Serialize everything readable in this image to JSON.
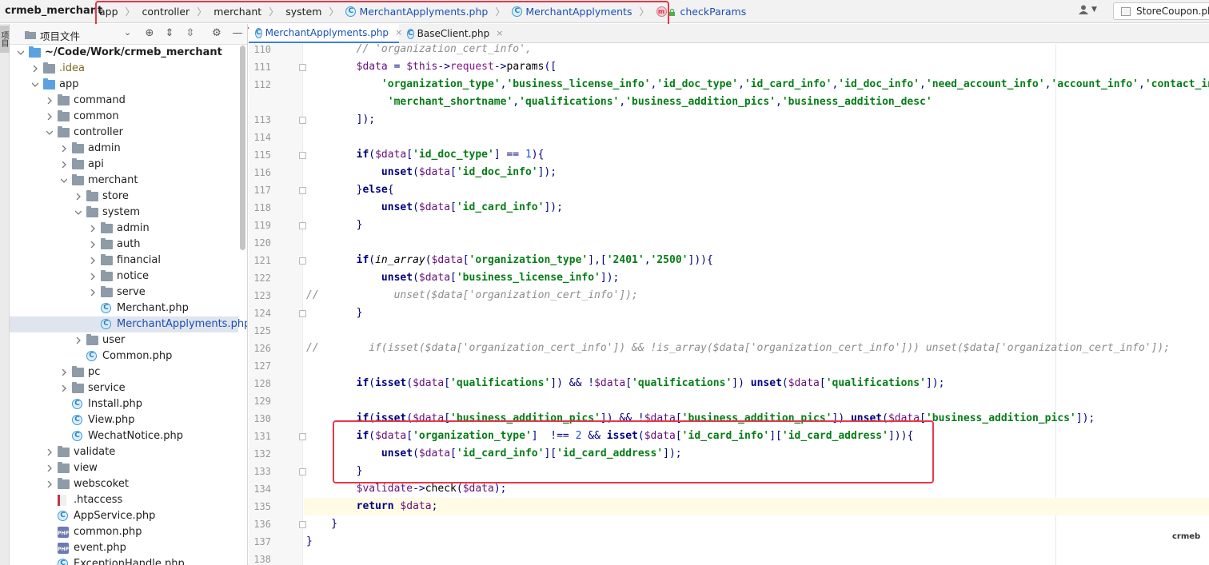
{
  "navbar": {
    "project_name": "crmeb_merchant",
    "breadcrumb": [
      "app",
      "controller",
      "merchant",
      "system",
      "MerchantApplyments.php",
      "MerchantApplyments",
      "checkParams"
    ],
    "run_config": "StoreCoupon.php"
  },
  "tool_strip": {
    "tab_label": "项目"
  },
  "project_panel": {
    "title": "项目文件",
    "tree": [
      {
        "label": "~/Code/Work/crmeb_merchant",
        "type": "folder-blue",
        "depth": 0,
        "expanded": true,
        "bold": true
      },
      {
        "label": ".idea",
        "type": "folder",
        "depth": 1,
        "expanded": false,
        "muted": true
      },
      {
        "label": "app",
        "type": "folder-blue",
        "depth": 1,
        "expanded": true
      },
      {
        "label": "command",
        "type": "folder",
        "depth": 2,
        "expanded": false
      },
      {
        "label": "common",
        "type": "folder",
        "depth": 2,
        "expanded": false
      },
      {
        "label": "controller",
        "type": "folder",
        "depth": 2,
        "expanded": true
      },
      {
        "label": "admin",
        "type": "folder",
        "depth": 3,
        "expanded": false
      },
      {
        "label": "api",
        "type": "folder",
        "depth": 3,
        "expanded": false
      },
      {
        "label": "merchant",
        "type": "folder",
        "depth": 3,
        "expanded": true
      },
      {
        "label": "store",
        "type": "folder",
        "depth": 4,
        "expanded": false
      },
      {
        "label": "system",
        "type": "folder",
        "depth": 4,
        "expanded": true
      },
      {
        "label": "admin",
        "type": "folder",
        "depth": 5,
        "expanded": false
      },
      {
        "label": "auth",
        "type": "folder",
        "depth": 5,
        "expanded": false
      },
      {
        "label": "financial",
        "type": "folder",
        "depth": 5,
        "expanded": false
      },
      {
        "label": "notice",
        "type": "folder",
        "depth": 5,
        "expanded": false
      },
      {
        "label": "serve",
        "type": "folder",
        "depth": 5,
        "expanded": false
      },
      {
        "label": "Merchant.php",
        "type": "php-class",
        "depth": 5
      },
      {
        "label": "MerchantApplyments.php",
        "type": "php-class",
        "depth": 5,
        "selected": true
      },
      {
        "label": "user",
        "type": "folder",
        "depth": 4,
        "expanded": false
      },
      {
        "label": "Common.php",
        "type": "php-class",
        "depth": 4
      },
      {
        "label": "pc",
        "type": "folder",
        "depth": 3,
        "expanded": false
      },
      {
        "label": "service",
        "type": "folder",
        "depth": 3,
        "expanded": false
      },
      {
        "label": "Install.php",
        "type": "php-class",
        "depth": 3
      },
      {
        "label": "View.php",
        "type": "php-class",
        "depth": 3
      },
      {
        "label": "WechatNotice.php",
        "type": "php-class",
        "depth": 3
      },
      {
        "label": "validate",
        "type": "folder",
        "depth": 2,
        "expanded": false
      },
      {
        "label": "view",
        "type": "folder",
        "depth": 2,
        "expanded": false
      },
      {
        "label": "webscoket",
        "type": "folder",
        "depth": 2,
        "expanded": false
      },
      {
        "label": ".htaccess",
        "type": "htaccess",
        "depth": 2
      },
      {
        "label": "AppService.php",
        "type": "php-class",
        "depth": 2
      },
      {
        "label": "common.php",
        "type": "php-file",
        "depth": 2
      },
      {
        "label": "event.php",
        "type": "php-file",
        "depth": 2
      },
      {
        "label": "ExceptionHandle.php",
        "type": "php-class",
        "depth": 2
      }
    ]
  },
  "editor": {
    "tabs": [
      {
        "label": "MerchantApplyments.php",
        "active": true
      },
      {
        "label": "BaseClient.php",
        "active": false
      }
    ],
    "current_line": 135,
    "lines": [
      {
        "n": "110",
        "html": "        <span class=\"cm\">// 'organization_cert_info',</span>"
      },
      {
        "n": "111",
        "html": "        <span class=\"vr\">$data</span> = <span class=\"vr\">$this</span>-&gt;<span class=\"ml\">request</span>-&gt;<span class=\"df\">params</span>(["
      },
      {
        "n": "112",
        "html": "            <span class=\"st\">'organization_type'</span>,<span class=\"st\">'business_license_info'</span>,<span class=\"st\">'id_doc_type'</span>,<span class=\"st\">'id_card_info'</span>,<span class=\"st\">'id_doc_info'</span>,<span class=\"st\">'need_account_info'</span>,<span class=\"st\">'account_info'</span>,<span class=\"st\">'contact_info'</span>,"
      },
      {
        "n": "",
        "html": "             <span class=\"st\">'merchant_shortname'</span>,<span class=\"st\">'qualifications'</span>,<span class=\"st\">'business_addition_pics'</span>,<span class=\"st\">'business_addition_desc'</span>"
      },
      {
        "n": "113",
        "html": "        ]);"
      },
      {
        "n": "114",
        "html": ""
      },
      {
        "n": "115",
        "html": "        <span class=\"kw\">if</span>(<span class=\"vr\">$data</span>[<span class=\"st\">'id_doc_type'</span>] == <span class=\"nm\">1</span>){"
      },
      {
        "n": "116",
        "html": "            <span class=\"kw\">unset</span>(<span class=\"vr\">$data</span>[<span class=\"st\">'id_doc_info'</span>]);"
      },
      {
        "n": "117",
        "html": "        }<span class=\"kw\">else</span>{"
      },
      {
        "n": "118",
        "html": "            <span class=\"kw\">unset</span>(<span class=\"vr\">$data</span>[<span class=\"st\">'id_card_info'</span>]);"
      },
      {
        "n": "119",
        "html": "        }"
      },
      {
        "n": "120",
        "html": ""
      },
      {
        "n": "121",
        "html": "        <span class=\"kw\">if</span>(<span class=\"fn-i\">in_array</span>(<span class=\"vr\">$data</span>[<span class=\"st\">'organization_type'</span>],[<span class=\"st\">'2401'</span>,<span class=\"st\">'2500'</span>])){"
      },
      {
        "n": "122",
        "html": "            <span class=\"kw\">unset</span>(<span class=\"vr\">$data</span>[<span class=\"st\">'business_license_info'</span>]);"
      },
      {
        "n": "123",
        "html": "<span class=\"cm\">//            unset($data['organization_cert_info']);</span>"
      },
      {
        "n": "124",
        "html": "        }"
      },
      {
        "n": "125",
        "html": ""
      },
      {
        "n": "126",
        "html": "<span class=\"cm\">//        if(isset($data['organization_cert_info']) &amp;&amp; !is_array($data['organization_cert_info'])) unset($data['organization_cert_info']);</span>"
      },
      {
        "n": "127",
        "html": ""
      },
      {
        "n": "128",
        "html": "        <span class=\"kw\">if</span>(<span class=\"kw\">isset</span>(<span class=\"vr\">$data</span>[<span class=\"st\">'qualifications'</span>]) &amp;&amp; !<span class=\"vr\">$data</span>[<span class=\"st\">'qualifications'</span>]) <span class=\"kw\">unset</span>(<span class=\"vr\">$data</span>[<span class=\"st\">'qualifications'</span>]);"
      },
      {
        "n": "129",
        "html": ""
      },
      {
        "n": "130",
        "html": "        <span class=\"kw\">if</span>(<span class=\"kw\">isset</span>(<span class=\"vr\">$data</span>[<span class=\"st\">'business_addition_pics'</span>]) &amp;&amp; !<span class=\"vr\">$data</span>[<span class=\"st\">'business_addition_pics'</span>]) <span class=\"kw\">unset</span>(<span class=\"vr\">$data</span>[<span class=\"st\">'business_addition_pics'</span>]);"
      },
      {
        "n": "131",
        "html": "        <span class=\"kw\">if</span>(<span class=\"vr\">$data</span>[<span class=\"st\">'organization_type'</span>]  !== <span class=\"nm\">2</span> &amp;&amp; <span class=\"kw\">isset</span>(<span class=\"vr\">$data</span>[<span class=\"st\">'id_card_info'</span>][<span class=\"st\">'id_card_address'</span>])){"
      },
      {
        "n": "132",
        "html": "            <span class=\"kw\">unset</span>(<span class=\"vr\">$data</span>[<span class=\"st\">'id_card_info'</span>][<span class=\"st\">'id_card_address'</span>]);"
      },
      {
        "n": "133",
        "html": "        }"
      },
      {
        "n": "134",
        "html": "        <span class=\"vr\">$validate</span>-&gt;<span class=\"df\">check</span>(<span class=\"vr\">$data</span>);"
      },
      {
        "n": "135",
        "html": "        <span class=\"kw\">return</span> <span class=\"vr\">$data</span>;"
      },
      {
        "n": "136",
        "html": "    }"
      },
      {
        "n": "137",
        "html": "}"
      },
      {
        "n": "138",
        "html": ""
      }
    ]
  },
  "watermark": "crmeb"
}
